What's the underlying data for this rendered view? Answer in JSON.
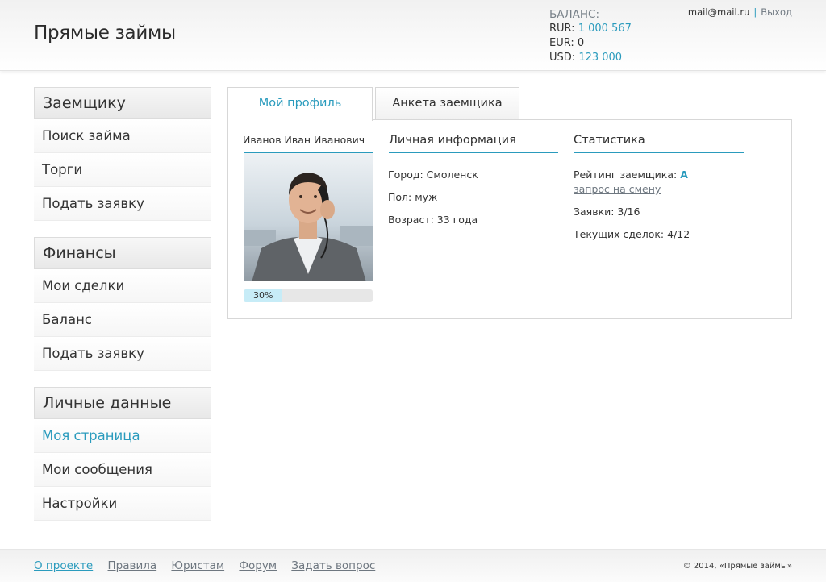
{
  "header": {
    "logo": "Прямые займы",
    "balance": {
      "title": "БАЛАНС:",
      "rows": [
        {
          "currency": "RUR:",
          "amount": "1 000 567"
        },
        {
          "currency": "EUR:",
          "amount": "0"
        },
        {
          "currency": "USD:",
          "amount": "123 000"
        }
      ]
    },
    "user": {
      "email": "mail@mail.ru",
      "separator": "|",
      "logout": "Выход"
    }
  },
  "sidebar": {
    "groups": [
      {
        "title": "Заемщику",
        "items": [
          "Поиск займа",
          "Торги",
          "Подать заявку"
        ]
      },
      {
        "title": "Финансы",
        "items": [
          "Мои сделки",
          "Баланс",
          "Подать заявку"
        ]
      },
      {
        "title": "Личные данные",
        "items": [
          "Моя страница",
          "Мои сообщения",
          "Настройки"
        ]
      }
    ],
    "active_item": "Моя страница"
  },
  "tabs": [
    {
      "label": "Мой профиль",
      "active": true
    },
    {
      "label": "Анкета заемщика",
      "active": false
    }
  ],
  "profile": {
    "name": "Иванов Иван Иванович",
    "progress_percent": 30,
    "progress_label": "30%",
    "personal": {
      "title": "Личная информация",
      "city": "Город: Смоленск",
      "gender": "Пол: муж",
      "age": "Возраст: 33 года"
    },
    "stats": {
      "title": "Статистика",
      "rating_label": "Рейтинг заемщика:",
      "rating_value": "A",
      "change_request": "запрос на смену",
      "applications": "Заявки: 3/16",
      "current_deals": "Текущих сделок: 4/12"
    }
  },
  "footer": {
    "links": [
      "О проекте",
      "Правила",
      "Юристам",
      "Форум",
      "Задать вопрос"
    ],
    "copyright": "© 2014, «Прямые займы»"
  },
  "colors": {
    "accent": "#2a9bbd",
    "muted": "#6e7780"
  }
}
